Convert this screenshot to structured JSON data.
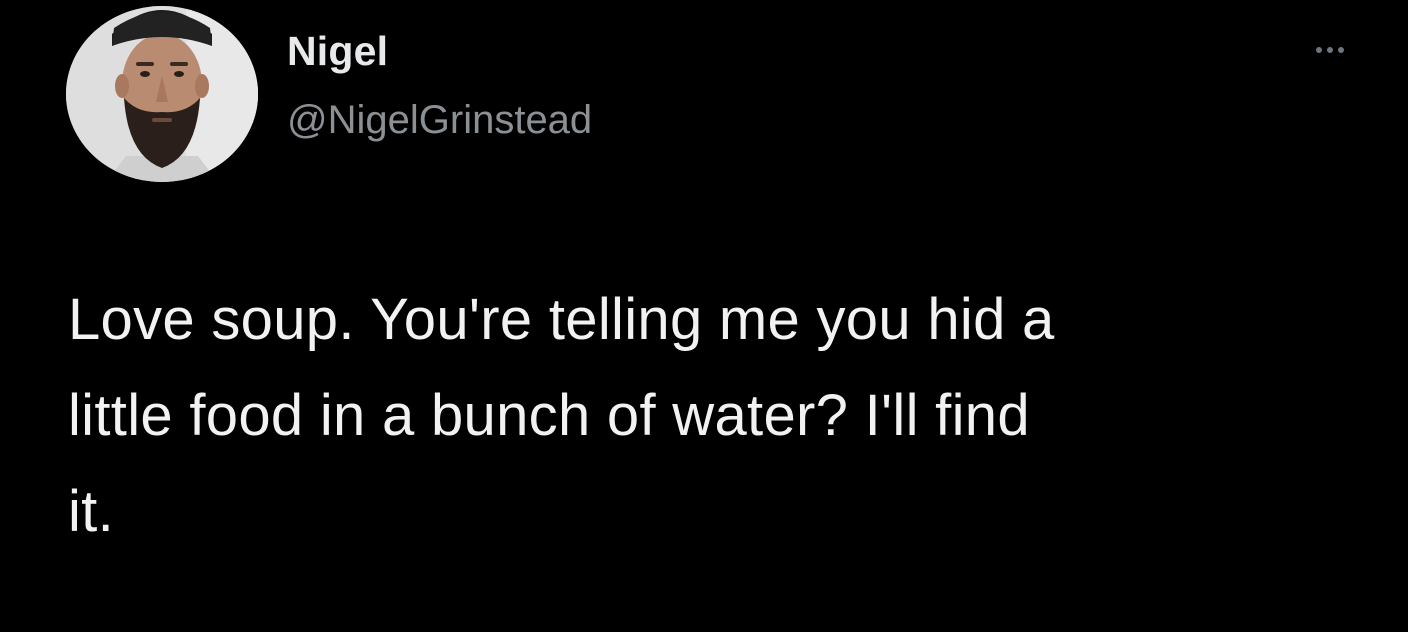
{
  "tweet": {
    "author": {
      "display_name": "Nigel",
      "handle": "@NigelGrinstead",
      "avatar_icon": "profile-photo"
    },
    "more_icon": "more-horizontal-icon",
    "text": "Love soup. You're telling me you hid a\nlittle food in a bunch of water? I'll find\nit."
  },
  "colors": {
    "background": "#000000",
    "primary_text": "#e7e9ea",
    "secondary_text": "#8b9095"
  }
}
